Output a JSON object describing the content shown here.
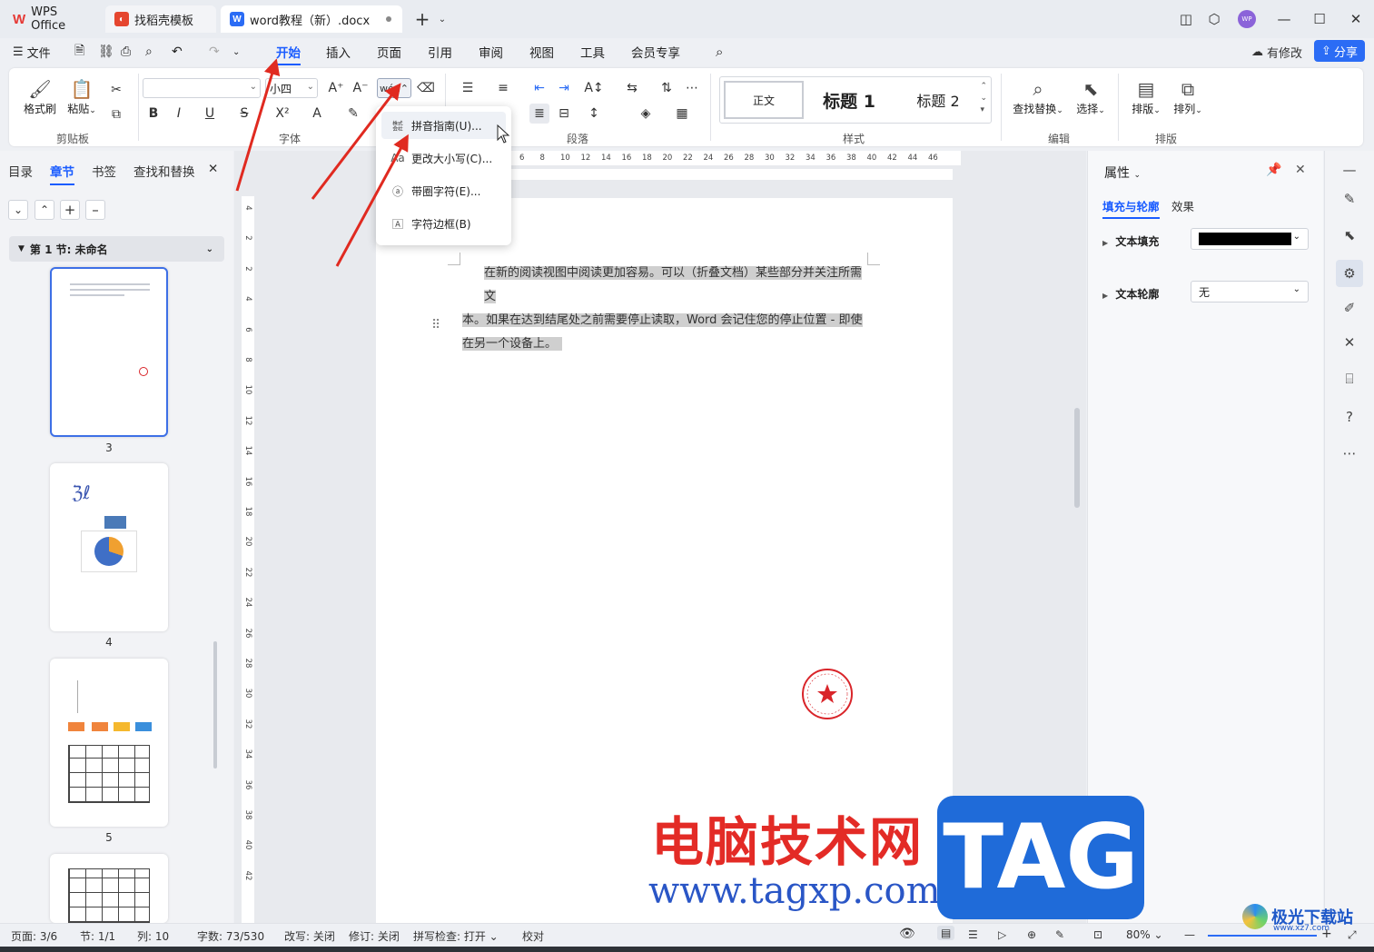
{
  "titlebar": {
    "tabs": [
      {
        "label": "WPS Office"
      },
      {
        "label": "找稻壳模板"
      },
      {
        "label": "word教程（新）.docx"
      }
    ],
    "new_tab": "+",
    "avatar": "WP"
  },
  "menubar": {
    "file": "文件",
    "items": [
      "开始",
      "插入",
      "页面",
      "引用",
      "审阅",
      "视图",
      "工具",
      "会员专享"
    ],
    "active": "开始",
    "edit_btn": "有修改",
    "share_btn": "分享"
  },
  "ribbon": {
    "clipboard": {
      "format_painter": "格式刷",
      "paste": "粘贴",
      "label": "剪贴板"
    },
    "font": {
      "font_name": "",
      "font_size": "小四",
      "label": "字体"
    },
    "paragraph": {
      "label": "段落"
    },
    "styles": {
      "normal": "正文",
      "h1": "标题 1",
      "h2": "标题 2",
      "label": "样式"
    },
    "edit": {
      "find_replace": "查找替换",
      "select": "选择",
      "label": "编辑"
    },
    "layout": {
      "arrange": "排版",
      "sort": "排列",
      "label": "排版"
    }
  },
  "dropdown": {
    "items": [
      {
        "label": "拼音指南(U)...",
        "icon": "pinyin-icon"
      },
      {
        "label": "更改大小写(C)...",
        "icon": "case-icon"
      },
      {
        "label": "带圈字符(E)...",
        "icon": "circled-char-icon"
      },
      {
        "label": "字符边框(B)",
        "icon": "char-border-icon"
      }
    ]
  },
  "leftpanel": {
    "tabs": [
      "目录",
      "章节",
      "书签",
      "查找和替换"
    ],
    "active": "章节",
    "section": "第 1 节: 未命名",
    "pages": [
      "3",
      "4",
      "5"
    ]
  },
  "ruler": {
    "h": [
      "6",
      "8",
      "10",
      "12",
      "14",
      "16",
      "18",
      "20",
      "22",
      "24",
      "26",
      "28",
      "30",
      "32",
      "34",
      "36",
      "38",
      "40",
      "42",
      "44",
      "46"
    ],
    "v": [
      "4",
      "2",
      "2",
      "4",
      "6",
      "8",
      "10",
      "12",
      "14",
      "16",
      "18",
      "20",
      "22",
      "24",
      "26",
      "28",
      "30",
      "32",
      "34",
      "36",
      "38",
      "40",
      "42"
    ]
  },
  "document": {
    "line1": "在新的阅读视图中阅读更加容易。可以（折叠文档）某些部分并关注所需文",
    "line2": "本。如果在达到结尾处之前需要停止读取，Word 会记住您的停止位置 - 即使",
    "line3": "在另一个设备上。"
  },
  "rightpanel": {
    "title": "属性",
    "tabs": [
      "填充与轮廓",
      "效果"
    ],
    "active": "填充与轮廓",
    "text_fill_label": "文本填充",
    "text_fill_color": "#000000",
    "text_outline_label": "文本轮廓",
    "text_outline_value": "无"
  },
  "statusbar": {
    "page": "页面: 3/6",
    "section": "节: 1/1",
    "col": "列: 10",
    "words": "字数: 73/530",
    "overtype": "改写: 关闭",
    "revision": "修订: 关闭",
    "spellcheck": "拼写检查: 打开",
    "proof": "校对",
    "zoom": "80%"
  },
  "watermark": {
    "cn": "电脑技术网",
    "url": "www.tagxp.com",
    "tag": "TAG",
    "jg": "极光下载站",
    "jg_url": "www.xz7.com"
  },
  "colors": {
    "accent": "#1a5cff",
    "share": "#2b6cf5",
    "arrow": "#e02a20",
    "stamp": "#d9252a"
  }
}
